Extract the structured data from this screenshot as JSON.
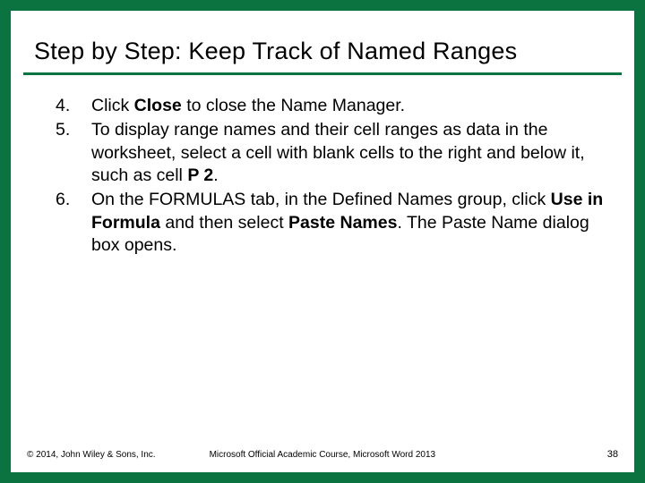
{
  "title": "Step by Step: Keep Track of Named Ranges",
  "steps": {
    "s4": {
      "pre": "Click ",
      "b1": "Close",
      "post": " to close the Name Manager."
    },
    "s5": {
      "pre": "To display range names and their cell ranges as data in the worksheet, select a cell with blank cells to the right and below it, such as cell ",
      "b1": "P 2",
      "post": "."
    },
    "s6": {
      "pre": "On the FORMULAS tab, in the Defined Names group, click ",
      "b1": "Use in Formula",
      "mid": " and then select ",
      "b2": "Paste Names",
      "post": ". The Paste Name dialog box opens."
    }
  },
  "footer": {
    "copyright": "© 2014, John Wiley & Sons, Inc.",
    "course": "Microsoft Official Academic Course, Microsoft Word 2013",
    "page": "38"
  }
}
